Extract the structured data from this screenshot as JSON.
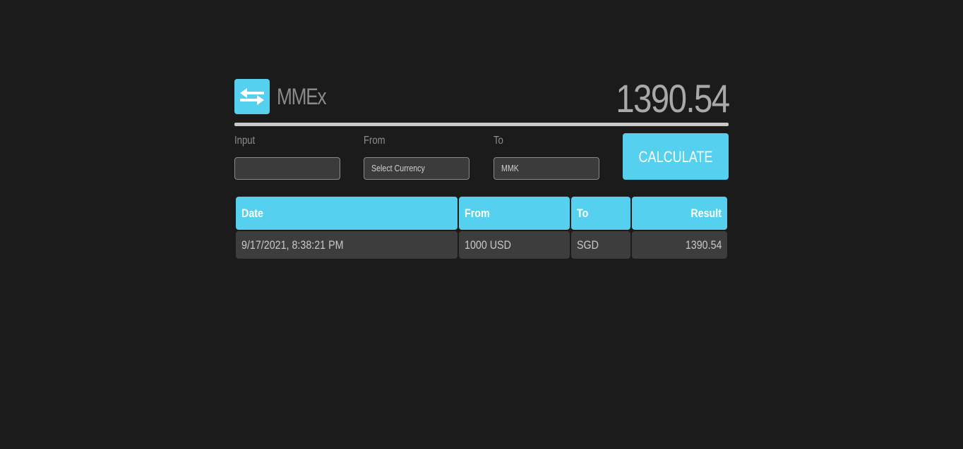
{
  "app": {
    "title": "MMEx",
    "result_value": "1390.54",
    "accent_color": "#55d0ee"
  },
  "logo": {
    "icon": "swap-arrows-icon"
  },
  "form": {
    "input_label": "Input",
    "input_value": "",
    "from_label": "From",
    "from_value": "Select Currency",
    "to_label": "To",
    "to_value": "MMK",
    "calculate_label": "CALCULATE"
  },
  "history": {
    "columns": [
      "Date",
      "From",
      "To",
      "Result"
    ],
    "rows": [
      {
        "date": "9/17/2021, 8:38:21 PM",
        "from": "1000 USD",
        "to": "SGD",
        "result": "1390.54"
      }
    ]
  }
}
